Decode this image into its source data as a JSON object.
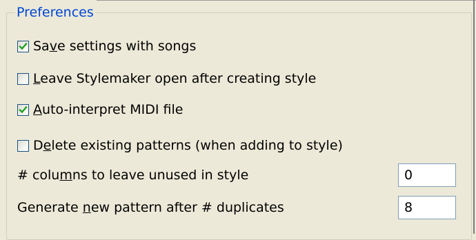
{
  "group": {
    "title": "Preferences"
  },
  "options": [
    {
      "pre": "Sa",
      "mnemonic": "v",
      "post": "e settings with songs",
      "checked": true
    },
    {
      "pre": "",
      "mnemonic": "L",
      "post": "eave Stylemaker open after creating style",
      "checked": false
    },
    {
      "pre": "",
      "mnemonic": "A",
      "post": "uto-interpret MIDI file",
      "checked": true
    },
    {
      "pre": "D",
      "mnemonic": "e",
      "post": "lete existing patterns (when adding to style)",
      "checked": false
    }
  ],
  "fields": [
    {
      "pre": "# colu",
      "mnemonic": "m",
      "post": "ns to leave unused in style",
      "value": "0"
    },
    {
      "pre": "Generate ",
      "mnemonic": "n",
      "post": "ew pattern after # duplicates",
      "value": "8"
    }
  ],
  "colors": {
    "title": "#0046d5",
    "check": "#21a121",
    "checkbox_border": "#1c5180",
    "textbox_border": "#7f9db9"
  }
}
